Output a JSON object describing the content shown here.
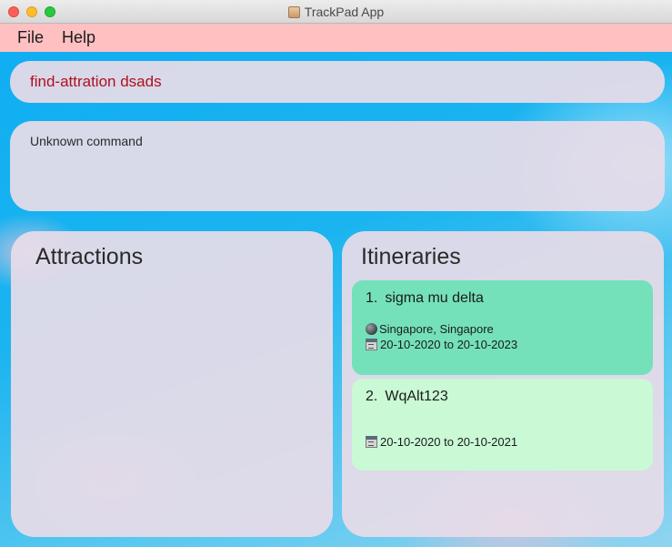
{
  "window": {
    "title": "TrackPad App"
  },
  "menu": [
    {
      "label": "File"
    },
    {
      "label": "Help"
    }
  ],
  "command": {
    "value": "find-attration dsads"
  },
  "result": {
    "text": "Unknown command"
  },
  "attractions": {
    "title": "Attractions",
    "items": []
  },
  "itineraries": {
    "title": "Itineraries",
    "items": [
      {
        "index": "1.",
        "name": "sigma mu delta",
        "location": "Singapore, Singapore",
        "dates": "20-10-2020 to 20-10-2023"
      },
      {
        "index": "2.",
        "name": "WqAlt123",
        "location": "",
        "dates": "20-10-2020 to 20-10-2021"
      }
    ]
  },
  "colors": {
    "menubar_bg": "#ffc0c2",
    "command_text": "#b0101e",
    "card_selected": "#74e1ba",
    "card_default": "#c9f9d5"
  },
  "icons": {
    "location": "globe-icon",
    "date": "calendar-icon",
    "app": "app-icon"
  }
}
